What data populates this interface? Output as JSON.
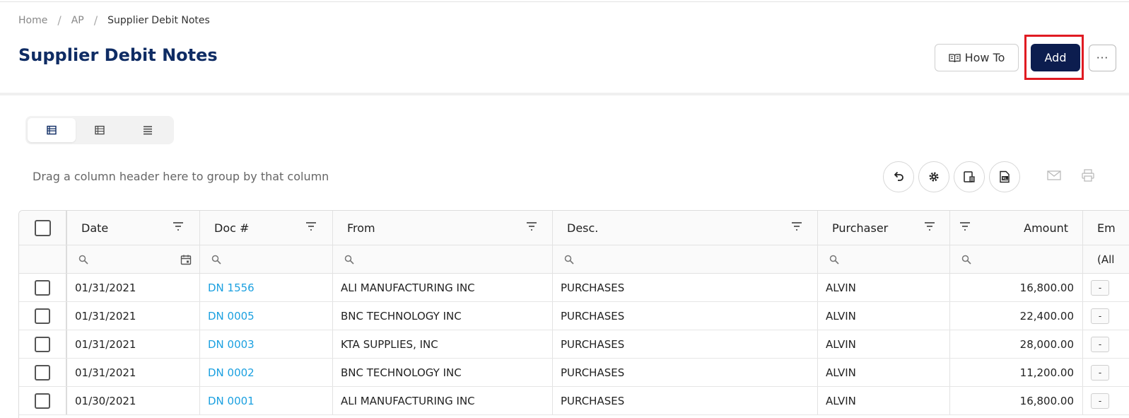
{
  "breadcrumb": {
    "items": [
      "Home",
      "AP",
      "Supplier Debit Notes"
    ],
    "separator": "/"
  },
  "page": {
    "title": "Supplier Debit Notes"
  },
  "header_actions": {
    "howto_label": "How To",
    "add_label": "Add",
    "more_label": "···"
  },
  "colors": {
    "title": "#0f2c64",
    "add_button": "#0c1d4f",
    "highlight": "#e01b22",
    "link": "#1ba0e0"
  },
  "view_toggle": {
    "icons": [
      "list-view-icon",
      "grid-view-icon",
      "compact-view-icon"
    ],
    "active": 0
  },
  "toolbar": {
    "group_hint": "Drag a column header here to group by that column",
    "icons": [
      "undo-icon",
      "settings-icon",
      "column-chooser-icon",
      "export-excel-icon",
      "email-icon",
      "print-icon"
    ]
  },
  "grid": {
    "columns": [
      "Date",
      "Doc #",
      "From",
      "Desc.",
      "Purchaser",
      "Amount",
      "Em"
    ],
    "email_filter_value": "(All",
    "rows": [
      {
        "date": "01/31/2021",
        "doc": "DN 1556",
        "from": "ALI MANUFACTURING INC",
        "desc": "PURCHASES",
        "purchaser": "ALVIN",
        "amount": "16,800.00",
        "em": "-"
      },
      {
        "date": "01/31/2021",
        "doc": "DN 0005",
        "from": "BNC TECHNOLOGY INC",
        "desc": "PURCHASES",
        "purchaser": "ALVIN",
        "amount": "22,400.00",
        "em": "-"
      },
      {
        "date": "01/31/2021",
        "doc": "DN 0003",
        "from": "KTA SUPPLIES, INC",
        "desc": "PURCHASES",
        "purchaser": "ALVIN",
        "amount": "28,000.00",
        "em": "-"
      },
      {
        "date": "01/31/2021",
        "doc": "DN 0002",
        "from": "BNC TECHNOLOGY INC",
        "desc": "PURCHASES",
        "purchaser": "ALVIN",
        "amount": "11,200.00",
        "em": "-"
      },
      {
        "date": "01/30/2021",
        "doc": "DN 0001",
        "from": "ALI MANUFACTURING INC",
        "desc": "PURCHASES",
        "purchaser": "ALVIN",
        "amount": "16,800.00",
        "em": "-"
      }
    ]
  }
}
